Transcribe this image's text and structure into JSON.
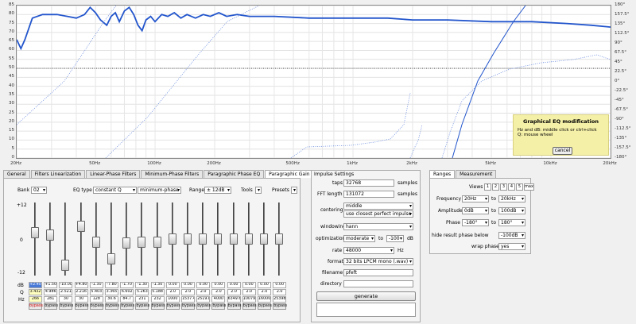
{
  "graph": {
    "y_left_ticks": [
      "85",
      "80",
      "75",
      "70",
      "65",
      "60",
      "55",
      "50",
      "45",
      "40",
      "35",
      "30",
      "25",
      "20",
      "15",
      "10",
      "5",
      "0"
    ],
    "y_right_ticks": [
      "180°",
      "157.5°",
      "135°",
      "112.5°",
      "90°",
      "67.5°",
      "45°",
      "22.5°",
      "0°",
      "-22.5°",
      "-45°",
      "-67.5°",
      "-90°",
      "-112.5°",
      "-135°",
      "-157.5°",
      "-180°"
    ],
    "x_ticks": [
      "20Hz",
      "50Hz",
      "100Hz",
      "200Hz",
      "500Hz",
      "1kHz",
      "2kHz",
      "5kHz",
      "10kHz",
      "20kHz"
    ],
    "colors": {
      "main": "#2255cc",
      "phase": "#6688dd"
    }
  },
  "eq_popup": {
    "title": "Graphical EQ modification",
    "line1": "Hz and dB: middle click or ctrl+click",
    "line2": "Q: mouse wheel",
    "cancel": "cancel"
  },
  "tabs_left": [
    "General",
    "Filters Linearization",
    "Linear-Phase Filters",
    "Minimum-Phase Filters",
    "Paragraphic Phase EQ",
    "Paragraphic Gain EQ"
  ],
  "tabs_left_active": "Paragraphic Gain EQ",
  "gain_eq": {
    "bank_label": "Bank",
    "bank_value": "02",
    "eq_type_label": "EQ type",
    "eq_type_value": "constant Q",
    "phase_value": "minimum-phase",
    "range_label": "Range",
    "range_value": "± 12dB",
    "tools_label": "Tools",
    "presets_label": "Presets",
    "scale_top": "+12",
    "scale_mid": "0",
    "scale_bot": "-12",
    "row_db": "dB",
    "row_q": "Q",
    "row_hz": "Hz",
    "bands": [
      {
        "db": "+2.40",
        "q": "3.432",
        "hz": "266",
        "bypass": "bypass",
        "level": 0.6
      },
      {
        "db": "+1.50",
        "q": "4.986",
        "hz": "281",
        "bypass": "bypass",
        "level": 0.56
      },
      {
        "db": "-10.00",
        "q": "2.521",
        "hz": "30",
        "bypass": "bypass",
        "level": 0.08
      },
      {
        "db": "+4.80",
        "q": "2.216",
        "hz": "30",
        "bypass": "bypass",
        "level": 0.7
      },
      {
        "db": "-1.30",
        "q": "5.403",
        "hz": "128",
        "bypass": "bypass",
        "level": 0.45
      },
      {
        "db": "-7.80",
        "q": "3.365",
        "hz": "30.6",
        "bypass": "bypass",
        "level": 0.18
      },
      {
        "db": "-1.70",
        "q": "6.602",
        "hz": "84.7",
        "bypass": "bypass",
        "level": 0.43
      },
      {
        "db": "-1.30",
        "q": "5.263",
        "hz": "231",
        "bypass": "bypass",
        "level": 0.45
      },
      {
        "db": "-1.30",
        "q": "5.188",
        "hz": "232",
        "bypass": "bypass",
        "level": 0.45
      },
      {
        "db": "0.00",
        "q": "2.0",
        "hz": "1000",
        "bypass": "bypass",
        "level": 0.5
      },
      {
        "db": "0.00",
        "q": "2.0",
        "hz": "1537.4",
        "bypass": "bypass",
        "level": 0.5
      },
      {
        "db": "0.00",
        "q": "2.0",
        "hz": "2519.8",
        "bypass": "bypass",
        "level": 0.5
      },
      {
        "db": "0.00",
        "q": "2.0",
        "hz": "4000",
        "bypass": "bypass",
        "level": 0.5
      },
      {
        "db": "0.00",
        "q": "2.0",
        "hz": "6349.6",
        "bypass": "bypass",
        "level": 0.5
      },
      {
        "db": "0.00",
        "q": "2.0",
        "hz": "10079",
        "bypass": "bypass",
        "level": 0.5
      },
      {
        "db": "0.00",
        "q": "2.0",
        "hz": "16000",
        "bypass": "bypass",
        "level": 0.5
      },
      {
        "db": "0.00",
        "q": "2.0",
        "hz": "25398",
        "bypass": "bypass",
        "level": 0.5
      }
    ]
  },
  "impulse": {
    "title": "Impulse Settings",
    "taps_label": "taps",
    "taps_value": "32768",
    "taps_unit": "samples",
    "fft_label": "FFT length",
    "fft_value": "131072",
    "fft_unit": "samples",
    "centering_label": "centering",
    "centering_value": "middle",
    "centering_value2": "use closest perfect impulse",
    "windowing_label": "windowing",
    "windowing_value": "hann",
    "optim_label": "optimization",
    "optim_value": "moderate",
    "optim_to": "to",
    "optim_db": "-100",
    "optim_unit": "dB",
    "rate_label": "rate",
    "rate_value": "48000",
    "rate_unit": "Hz",
    "format_label": "format",
    "format_value": "32 bits LPCM mono (.wav)",
    "filename_label": "filename",
    "filename_value": "pfeft",
    "directory_label": "directory",
    "directory_value": "",
    "generate": "generate"
  },
  "tabs_right": [
    "Ranges",
    "Measurement"
  ],
  "tabs_right_active": "Ranges",
  "ranges": {
    "views_label": "Views",
    "views": [
      "1",
      "2",
      "3",
      "4",
      "5",
      "max"
    ],
    "freq_label": "Frequency",
    "freq_from": "20Hz",
    "freq_to": "20kHz",
    "amp_label": "Amplitude",
    "amp_from": "0dB",
    "amp_to": "100dB",
    "phase_label": "Phase",
    "phase_from": "-180°",
    "phase_to": "180°",
    "to": "to",
    "hide_label": "hide result phase below",
    "hide_value": "-100dB",
    "wrap_label": "wrap phase",
    "wrap_value": "yes"
  }
}
